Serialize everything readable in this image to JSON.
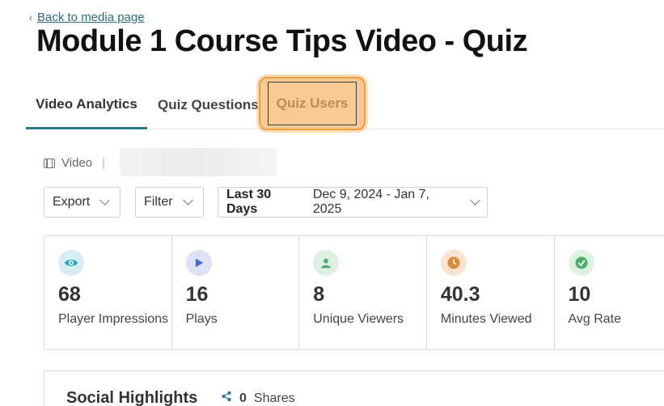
{
  "nav": {
    "back_label": "Back to media page"
  },
  "page": {
    "title": "Module 1 Course Tips Video - Quiz"
  },
  "tabs": [
    {
      "label": "Video Analytics",
      "active": true
    },
    {
      "label": "Quiz Questions",
      "active": false
    },
    {
      "label": "Quiz Users",
      "active": false,
      "highlighted": true
    }
  ],
  "media": {
    "type_label": "Video",
    "separator": "|"
  },
  "controls": {
    "export_label": "Export",
    "filter_label": "Filter",
    "range_label": "Last 30 Days",
    "range_dates": "Dec 9, 2024 - Jan 7, 2025"
  },
  "stats": [
    {
      "icon": "eye-icon",
      "color": "#2ca6bd",
      "value": "68",
      "label": "Player Impressions"
    },
    {
      "icon": "play-icon",
      "color": "#4a68c9",
      "value": "16",
      "label": "Plays"
    },
    {
      "icon": "user-icon",
      "color": "#4caf6a",
      "value": "8",
      "label": "Unique Viewers"
    },
    {
      "icon": "clock-icon",
      "color": "#d98a3d",
      "value": "40.3",
      "label": "Minutes Viewed"
    },
    {
      "icon": "check-icon",
      "color": "#4caf6a",
      "value": "10",
      "label": "Avg Rate"
    }
  ],
  "social": {
    "heading": "Social Highlights",
    "shares_count": "0",
    "shares_label": "Shares"
  },
  "colors": {
    "accent": "#2b7a87",
    "highlight": "#f29d3b"
  }
}
